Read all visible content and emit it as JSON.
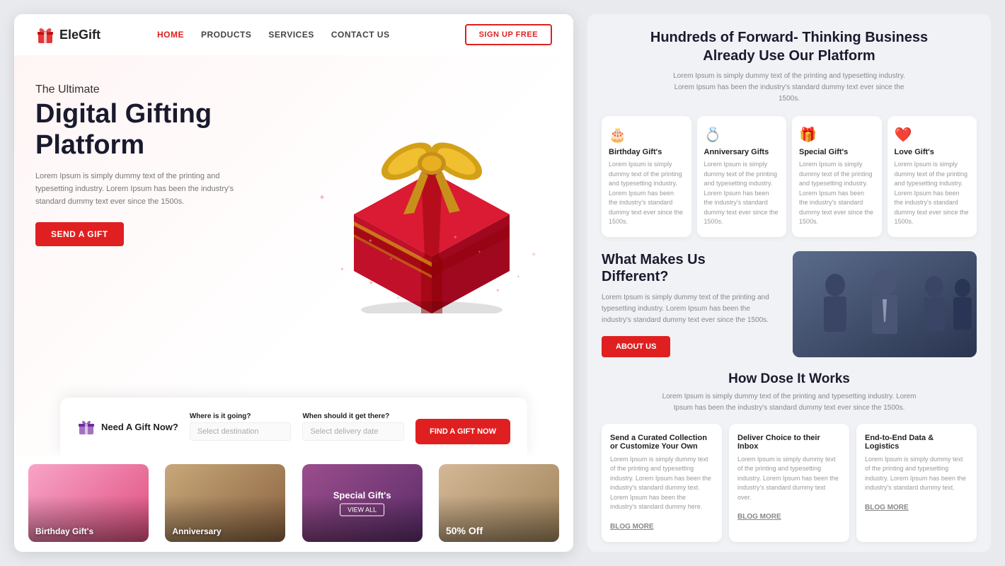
{
  "brand": {
    "name": "EleGift",
    "logo_icon": "🎁"
  },
  "navbar": {
    "links": [
      {
        "label": "HOME",
        "active": true
      },
      {
        "label": "PRODUCTS",
        "active": false
      },
      {
        "label": "SERVICES",
        "active": false
      },
      {
        "label": "CONTACT US",
        "active": false
      }
    ],
    "signup_label": "SIGN UP FREE"
  },
  "hero": {
    "subtitle": "The Ultimate",
    "title": "Digital Gifting Platform",
    "description": "Lorem Ipsum is simply dummy text of the printing and typesetting industry. Lorem Ipsum has been the industry's standard dummy text ever since the 1500s.",
    "cta_label": "SEND A GIFT"
  },
  "gift_finder": {
    "label": "Need A Gift Now?",
    "destination_label": "Where is it going?",
    "destination_placeholder": "Select destination",
    "delivery_label": "When should it get there?",
    "delivery_placeholder": "Select delivery date",
    "cta_label": "FIND A GIFT NOW"
  },
  "categories": [
    {
      "label": "Birthday Gift's",
      "color": "cat-pink"
    },
    {
      "label": "Anniversary",
      "color": "cat-brown"
    },
    {
      "label": "Special Gift's",
      "has_badge": true,
      "badge_text": "Special Gift's",
      "badge_btn": "VIEW ALL",
      "color": "cat-purple"
    },
    {
      "label": "50% Off",
      "is_discount": true,
      "color": "cat-tan"
    }
  ],
  "right": {
    "hundreds_title_line1": "Hundreds of Forward- Thinking Business",
    "hundreds_title_line2": "Already Use Our Platform",
    "hundreds_desc": "Lorem Ipsum is simply dummy text of the printing and typesetting industry. Lorem Ipsum has been the industry's standard dummy text ever since the 1500s.",
    "feature_cards": [
      {
        "icon": "🎂",
        "title": "Birthday Gift's",
        "desc": "Lorem Ipsum is simply dummy text of the printing and typesetting industry. Lorem Ipsum has been the industry's standard dummy text ever since the 1500s."
      },
      {
        "icon": "💍",
        "title": "Anniversary Gifts",
        "desc": "Lorem Ipsum is simply dummy text of the printing and typesetting industry. Lorem Ipsum has been the industry's standard dummy text ever since the 1500s."
      },
      {
        "icon": "🎁",
        "title": "Special Gift's",
        "desc": "Lorem Ipsum is simply dummy text of the printing and typesetting industry. Lorem Ipsum has been the industry's standard dummy text ever since the 1500s."
      },
      {
        "icon": "❤️",
        "title": "Love Gift's",
        "desc": "Lorem Ipsum is simply dummy text of the printing and typesetting industry. Lorem Ipsum has been the industry's standard dummy text ever since the 1500s."
      }
    ],
    "makes_title_line1": "What Makes Us",
    "makes_title_line2": "Different?",
    "makes_desc": "Lorem Ipsum is simply dummy text of the printing and typesetting industry. Lorem Ipsum has been the industry's standard dummy text ever since the 1500s.",
    "about_btn_label": "ABOUT US",
    "how_title": "How Dose It Works",
    "how_desc": "Lorem Ipsum is simply dummy text of the printing and typesetting industry. Lorem Ipsum has been the industry's standard dummy text ever since the 1500s.",
    "how_cards": [
      {
        "title": "Send a Curated Collection or Customize Your Own",
        "desc": "Lorem Ipsum is simply dummy text of the printing and typesetting industry. Lorem Ipsum has been the industry's standard dummy text. Lorem Ipsum has been the industry's standard dummy here.",
        "blog_label": "BLOG MORE"
      },
      {
        "title": "Deliver Choice to their Inbox",
        "desc": "Lorem Ipsum is simply dummy text of the printing and typesetting industry. Lorem Ipsum has been the industry's standard dummy text over.",
        "blog_label": "BLOG MORE"
      },
      {
        "title": "End-to-End Data & Logistics",
        "desc": "Lorem Ipsum is simply dummy text of the printing and typesetting industry. Lorem Ipsum has been the industry's standard dummy text.",
        "blog_label": "BLOG MORE"
      }
    ]
  }
}
